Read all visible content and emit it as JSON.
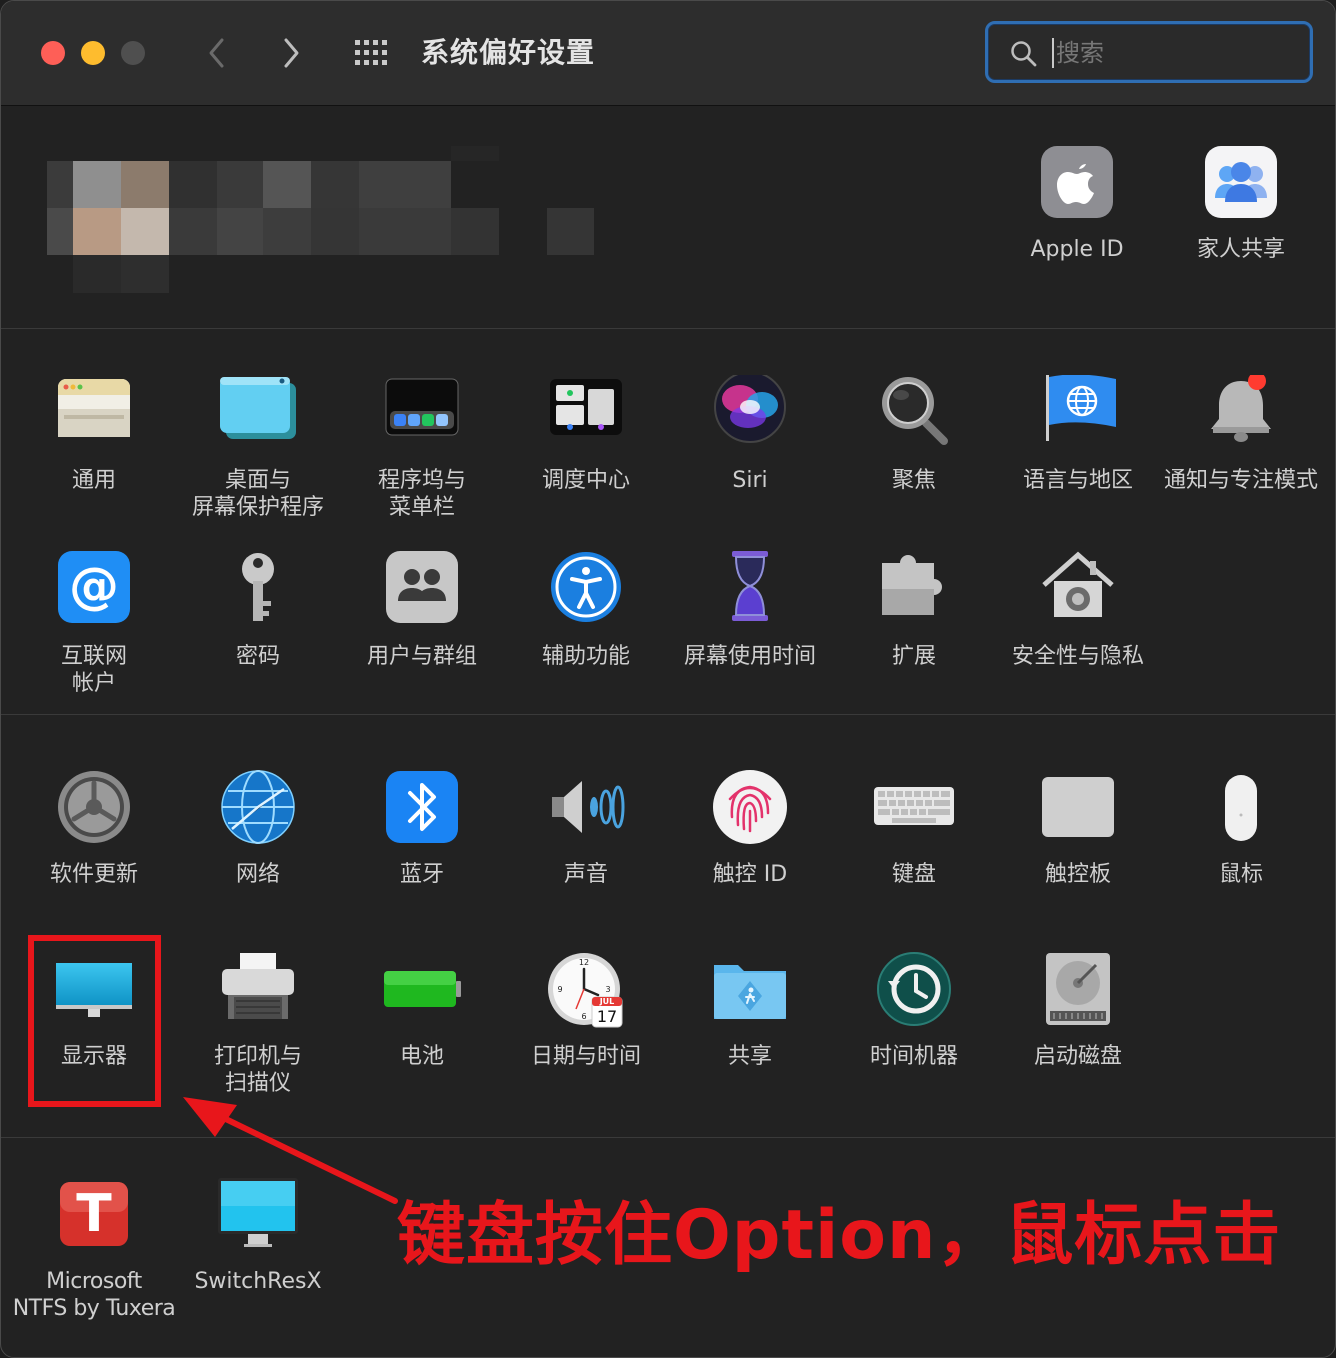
{
  "window": {
    "title": "系统偏好设置",
    "search_placeholder": "搜索"
  },
  "account": {
    "items": [
      {
        "label": "Apple ID",
        "icon": "apple-id-icon"
      },
      {
        "label": "家人共享",
        "icon": "family-sharing-icon"
      }
    ]
  },
  "section1": {
    "items": [
      {
        "label": "通用",
        "icon": "general-icon"
      },
      {
        "label": "桌面与\n屏幕保护程序",
        "icon": "desktop-screensaver-icon"
      },
      {
        "label": "程序坞与\n菜单栏",
        "icon": "dock-menubar-icon"
      },
      {
        "label": "调度中心",
        "icon": "mission-control-icon"
      },
      {
        "label": "Siri",
        "icon": "siri-icon"
      },
      {
        "label": "聚焦",
        "icon": "spotlight-icon"
      },
      {
        "label": "语言与地区",
        "icon": "language-region-icon"
      },
      {
        "label": "通知与专注模式",
        "icon": "notifications-icon"
      },
      {
        "label": "互联网\n帐户",
        "icon": "internet-accounts-icon"
      },
      {
        "label": "密码",
        "icon": "passwords-icon"
      },
      {
        "label": "用户与群组",
        "icon": "users-groups-icon"
      },
      {
        "label": "辅助功能",
        "icon": "accessibility-icon"
      },
      {
        "label": "屏幕使用时间",
        "icon": "screen-time-icon"
      },
      {
        "label": "扩展",
        "icon": "extensions-icon"
      },
      {
        "label": "安全性与隐私",
        "icon": "security-privacy-icon"
      }
    ]
  },
  "section2": {
    "items": [
      {
        "label": "软件更新",
        "icon": "software-update-icon"
      },
      {
        "label": "网络",
        "icon": "network-icon"
      },
      {
        "label": "蓝牙",
        "icon": "bluetooth-icon"
      },
      {
        "label": "声音",
        "icon": "sound-icon"
      },
      {
        "label": "触控 ID",
        "icon": "touch-id-icon"
      },
      {
        "label": "键盘",
        "icon": "keyboard-icon"
      },
      {
        "label": "触控板",
        "icon": "trackpad-icon"
      },
      {
        "label": "鼠标",
        "icon": "mouse-icon"
      },
      {
        "label": "显示器",
        "icon": "displays-icon"
      },
      {
        "label": "打印机与\n扫描仪",
        "icon": "printers-scanners-icon"
      },
      {
        "label": "电池",
        "icon": "battery-icon"
      },
      {
        "label": "日期与时间",
        "icon": "date-time-icon",
        "calendar_month": "JUL",
        "calendar_day": "17"
      },
      {
        "label": "共享",
        "icon": "sharing-icon"
      },
      {
        "label": "时间机器",
        "icon": "time-machine-icon"
      },
      {
        "label": "启动磁盘",
        "icon": "startup-disk-icon"
      }
    ]
  },
  "section3": {
    "items": [
      {
        "label": "Microsoft\nNTFS by Tuxera",
        "icon": "tuxera-ntfs-icon",
        "glyph": "T"
      },
      {
        "label": "SwitchResX",
        "icon": "switchresx-icon"
      }
    ]
  },
  "annotation": {
    "text": "键盘按住Option，鼠标点击",
    "color": "#e8161b"
  }
}
